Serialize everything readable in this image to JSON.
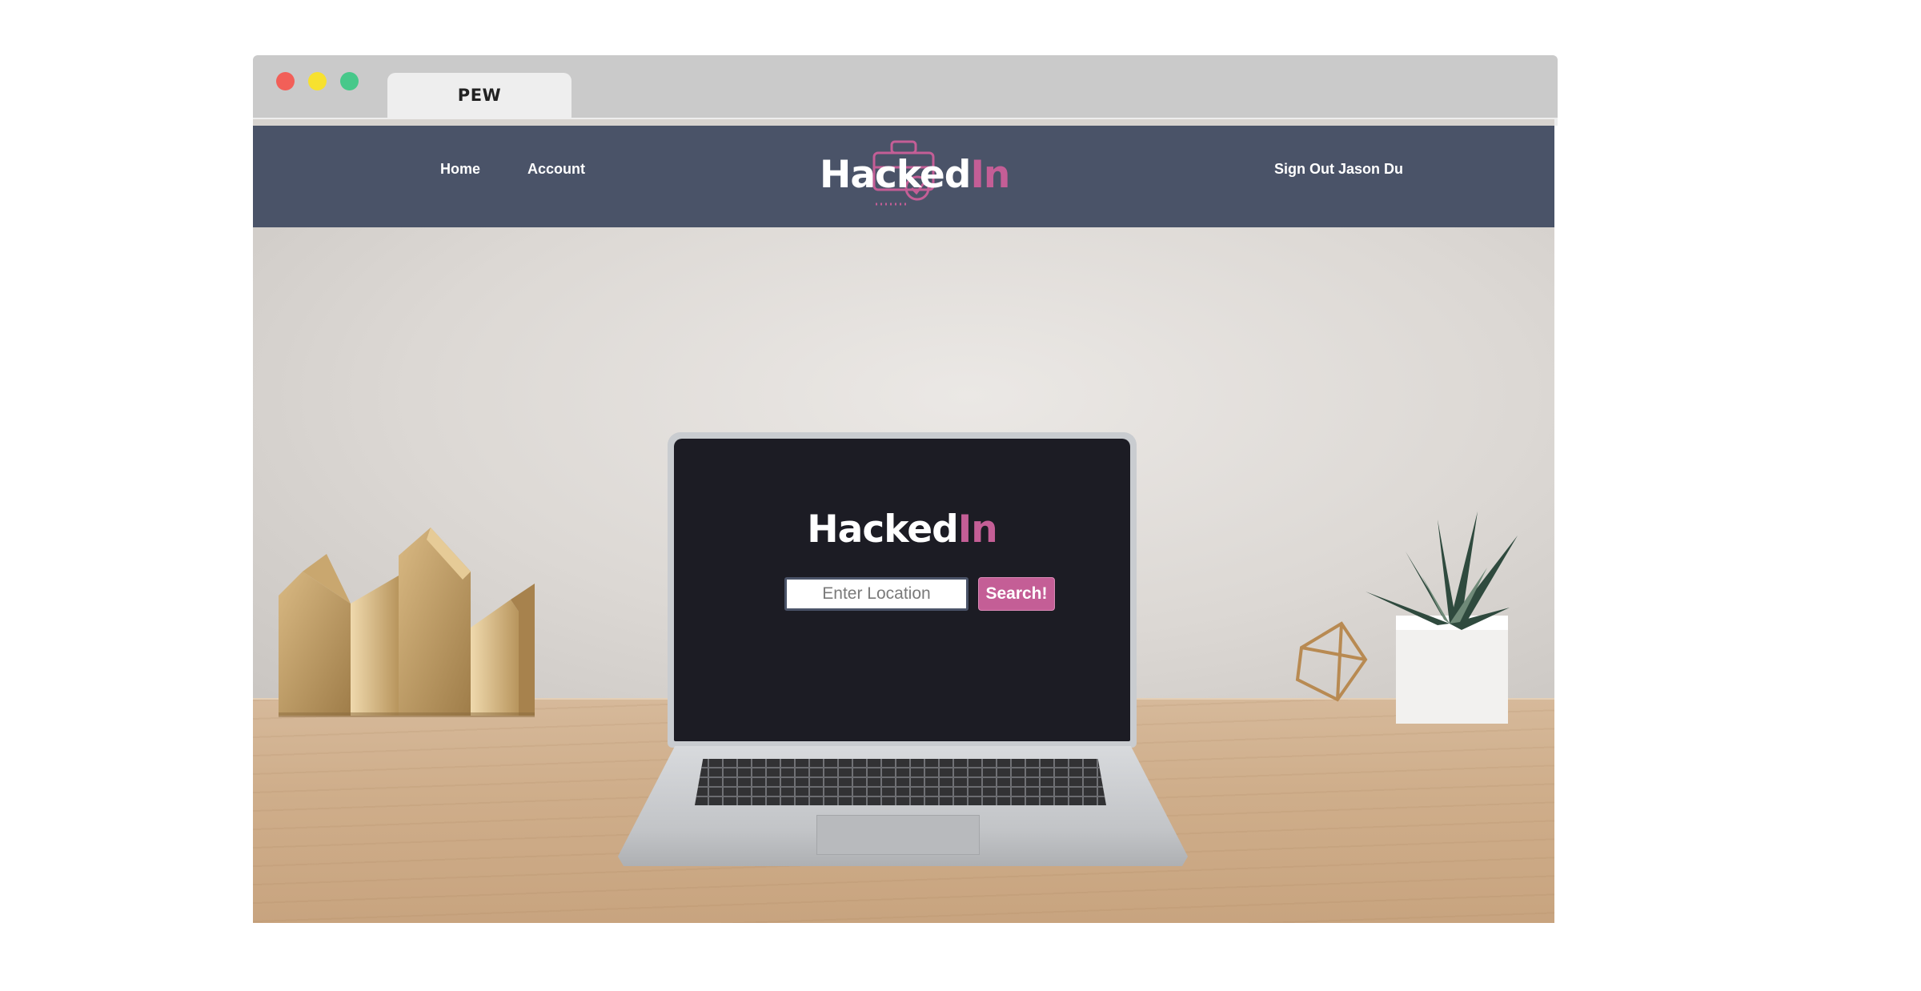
{
  "browser": {
    "tab_title": "PEW",
    "traffic_lights": {
      "close": "#f25f58",
      "minimize": "#f7e12f",
      "maximize": "#47c88a"
    }
  },
  "nav": {
    "home": "Home",
    "account": "Account",
    "sign_out": "Sign Out Jason Du"
  },
  "logo": {
    "part1": "Hacked",
    "part2": "In",
    "icon": "briefcase-icon"
  },
  "hero": {
    "title_part1": "Hacked",
    "title_part2": "In",
    "search_placeholder": "Enter Location",
    "search_value": "",
    "search_button": "Search!"
  },
  "colors": {
    "nav_background": "#4a5368",
    "accent_pink": "#c45e96",
    "window_chrome": "#cacaca",
    "tab_background": "#eeeeee"
  }
}
